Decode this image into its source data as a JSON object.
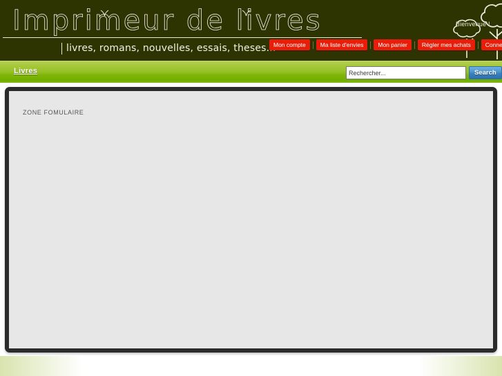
{
  "site": {
    "logo_title": "Imprimeur de livres",
    "tagline": "livres, romans, nouvelles, essais, theses...",
    "welcome": "Bienvenue !"
  },
  "topnav": {
    "items": [
      {
        "label": "Mon compte"
      },
      {
        "label": "Ma liste d'envies"
      },
      {
        "label": "Mon panier"
      },
      {
        "label": "Régler mes achats"
      },
      {
        "label": "Connexion"
      }
    ]
  },
  "navbar": {
    "menu": [
      {
        "label": "Livres"
      }
    ]
  },
  "search": {
    "placeholder": "Rechercher...",
    "value": "",
    "button_label": "Search"
  },
  "main": {
    "zone_label": "ZONE FOMULAIRE"
  },
  "colors": {
    "header_bg": "#2e3302",
    "navbar_green_light": "#a8c93c",
    "navbar_green_dark": "#6fae00",
    "button_red": "#e81e0a",
    "search_button_blue": "#3a81bd",
    "content_frame_dark": "#2b2b2b",
    "content_bg": "#e7e7e7",
    "footer_green": "#d9e3ae"
  }
}
